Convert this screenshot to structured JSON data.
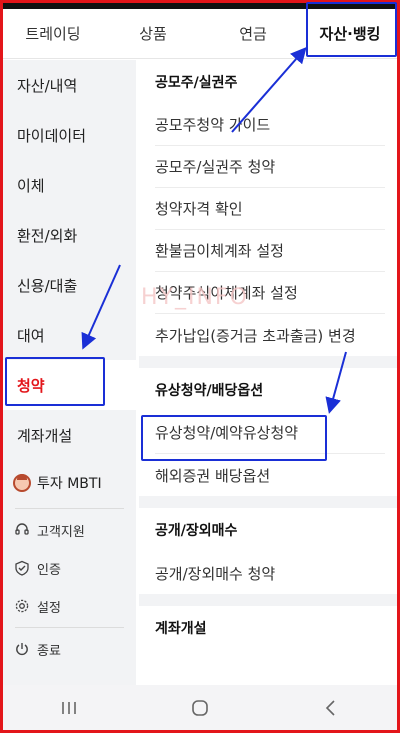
{
  "tabs": [
    {
      "label": "트레이딩"
    },
    {
      "label": "상품"
    },
    {
      "label": "연금"
    },
    {
      "label": "자산·뱅킹"
    }
  ],
  "sidebar": {
    "items": [
      {
        "label": "자산/내역"
      },
      {
        "label": "마이데이터"
      },
      {
        "label": "이체"
      },
      {
        "label": "환전/외화"
      },
      {
        "label": "신용/대출"
      },
      {
        "label": "대여"
      },
      {
        "label": "청약"
      },
      {
        "label": "계좌개설"
      }
    ],
    "mbti_label": "투자 MBTI",
    "support": [
      {
        "label": "고객지원",
        "icon": "headset-icon"
      },
      {
        "label": "인증",
        "icon": "shield-check-icon"
      },
      {
        "label": "설정",
        "icon": "gear-icon"
      }
    ],
    "exit_label": "종료"
  },
  "main": {
    "sections": [
      {
        "title": "공모주/실권주",
        "items": [
          "공모주청약 가이드",
          "공모주/실권주 청약",
          "청약자격 확인",
          "환불금이체계좌 설정",
          "청약주식이체계좌 설정",
          "추가납입(증거금 초과출금) 변경"
        ]
      },
      {
        "title": "유상청약/배당옵션",
        "items": [
          "유상청약/예약유상청약",
          "해외증권 배당옵션"
        ]
      },
      {
        "title": "공개/장외매수",
        "items": [
          "공개/장외매수 청약"
        ]
      },
      {
        "title": "계좌개설",
        "items": []
      }
    ],
    "watermark": "HY_INFO"
  },
  "colors": {
    "accent_red": "#e3151a",
    "highlight_blue": "#1a2fd6",
    "sidebar_bg": "#f2f3f5"
  }
}
